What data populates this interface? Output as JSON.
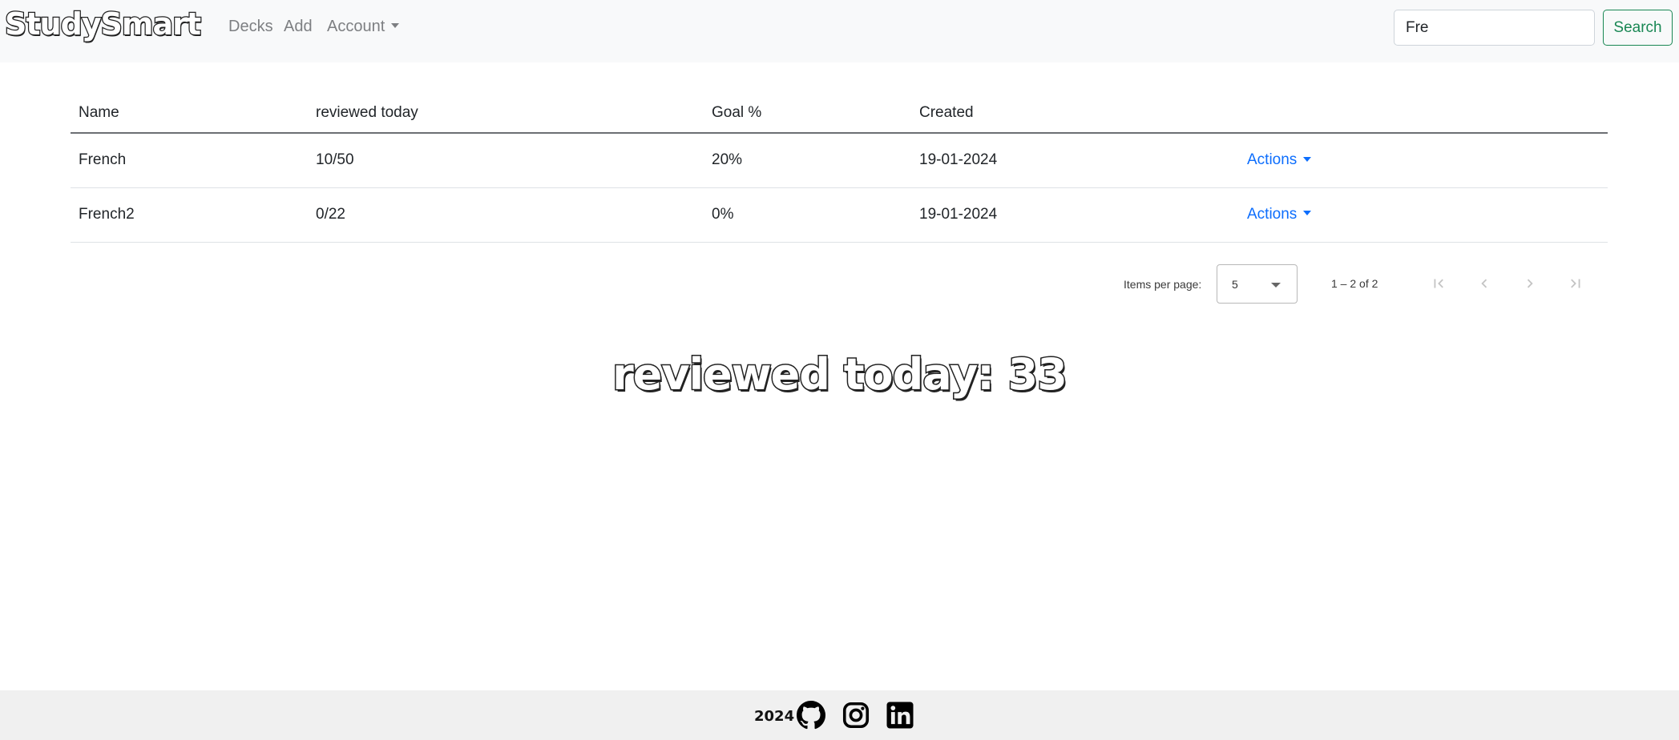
{
  "navbar": {
    "brand": "StudySmart",
    "links": {
      "decks": "Decks",
      "add": "Add",
      "account": "Account"
    },
    "search": {
      "value": "Fre",
      "button_label": "Search"
    }
  },
  "table": {
    "headers": {
      "name": "Name",
      "reviewed": "reviewed today",
      "goal": "Goal %",
      "created": "Created"
    },
    "rows": [
      {
        "name": "French",
        "reviewed": "10/50",
        "goal": "20%",
        "created": "19-01-2024",
        "actions": "Actions"
      },
      {
        "name": "French2",
        "reviewed": "0/22",
        "goal": "0%",
        "created": "19-01-2024",
        "actions": "Actions"
      }
    ]
  },
  "paginator": {
    "items_per_page_label": "Items per page:",
    "items_per_page_value": "5",
    "range_label": "1 – 2 of 2"
  },
  "summary": {
    "reviewed_today": "reviewed today: 33"
  },
  "footer": {
    "year": "2024"
  },
  "colors": {
    "link": "#0d6efd",
    "search_button": "#198754",
    "navbar_bg": "#f8f9fa",
    "footer_bg": "#f0f0f0"
  },
  "icons": [
    "github-icon",
    "instagram-icon",
    "linkedin-icon",
    "first-page-icon",
    "previous-page-icon",
    "next-page-icon",
    "last-page-icon",
    "caret-down-icon"
  ]
}
